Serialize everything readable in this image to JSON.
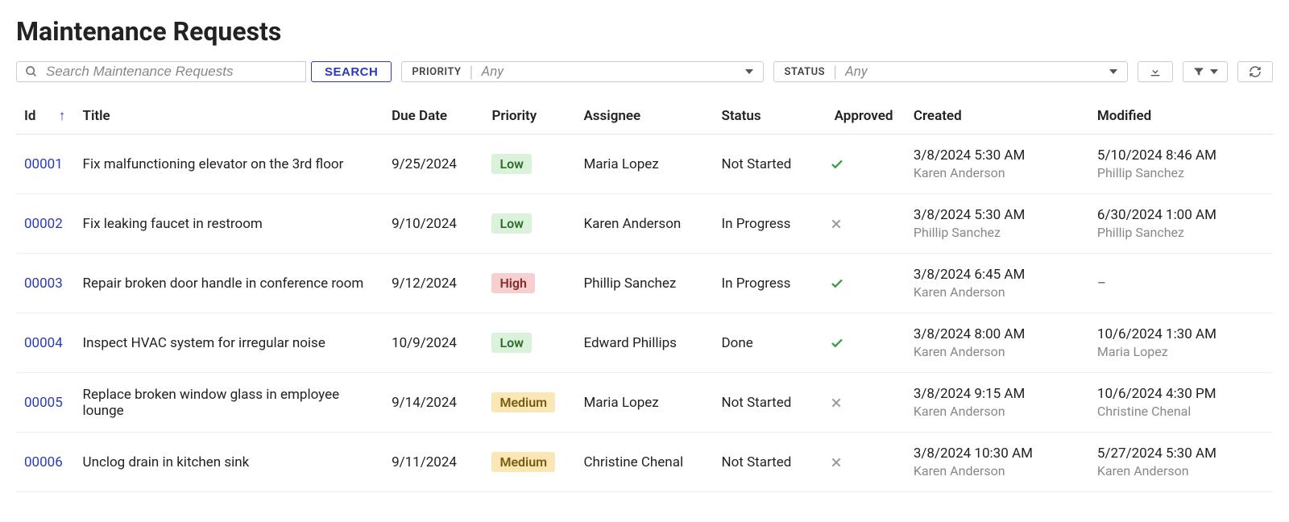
{
  "page_title": "Maintenance Requests",
  "toolbar": {
    "search_placeholder": "Search Maintenance Requests",
    "search_button": "SEARCH",
    "priority_label": "PRIORITY",
    "priority_value": "Any",
    "status_label": "STATUS",
    "status_value": "Any"
  },
  "columns": {
    "id": "Id",
    "title": "Title",
    "due": "Due Date",
    "priority": "Priority",
    "assignee": "Assignee",
    "status": "Status",
    "approved": "Approved",
    "created": "Created",
    "modified": "Modified"
  },
  "rows": [
    {
      "id": "00001",
      "title": "Fix malfunctioning elevator on the 3rd floor",
      "due": "9/25/2024",
      "priority": "Low",
      "assignee": "Maria Lopez",
      "status": "Not Started",
      "approved": true,
      "created_ts": "3/8/2024 5:30 AM",
      "created_by": "Karen Anderson",
      "modified_ts": "5/10/2024 8:46 AM",
      "modified_by": "Phillip Sanchez"
    },
    {
      "id": "00002",
      "title": "Fix leaking faucet in restroom",
      "due": "9/10/2024",
      "priority": "Low",
      "assignee": "Karen Anderson",
      "status": "In Progress",
      "approved": false,
      "created_ts": "3/8/2024 5:30 AM",
      "created_by": "Phillip Sanchez",
      "modified_ts": "6/30/2024 1:00 AM",
      "modified_by": "Phillip Sanchez"
    },
    {
      "id": "00003",
      "title": "Repair broken door handle in conference room",
      "due": "9/12/2024",
      "priority": "High",
      "assignee": "Phillip Sanchez",
      "status": "In Progress",
      "approved": true,
      "created_ts": "3/8/2024 6:45 AM",
      "created_by": "Karen Anderson",
      "modified_ts": "–",
      "modified_by": ""
    },
    {
      "id": "00004",
      "title": "Inspect HVAC system for irregular noise",
      "due": "10/9/2024",
      "priority": "Low",
      "assignee": "Edward Phillips",
      "status": "Done",
      "approved": true,
      "created_ts": "3/8/2024 8:00 AM",
      "created_by": "Karen Anderson",
      "modified_ts": "10/6/2024 1:30 AM",
      "modified_by": "Maria Lopez"
    },
    {
      "id": "00005",
      "title": "Replace broken window glass in employee lounge",
      "due": "9/14/2024",
      "priority": "Medium",
      "assignee": "Maria Lopez",
      "status": "Not Started",
      "approved": false,
      "created_ts": "3/8/2024 9:15 AM",
      "created_by": "Karen Anderson",
      "modified_ts": "10/6/2024 4:30 PM",
      "modified_by": "Christine Chenal"
    },
    {
      "id": "00006",
      "title": "Unclog drain in kitchen sink",
      "due": "9/11/2024",
      "priority": "Medium",
      "assignee": "Christine Chenal",
      "status": "Not Started",
      "approved": false,
      "created_ts": "3/8/2024 10:30 AM",
      "created_by": "Karen Anderson",
      "modified_ts": "5/27/2024 5:30 AM",
      "modified_by": "Karen Anderson"
    }
  ]
}
